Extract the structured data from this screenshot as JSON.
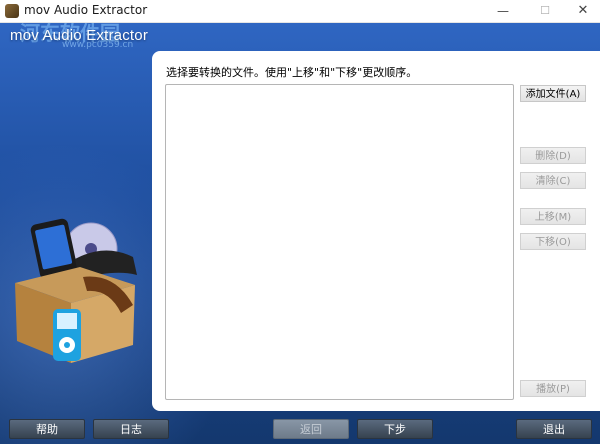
{
  "window": {
    "title": "mov Audio Extractor",
    "minimize": "—",
    "maximize": "☐",
    "close": "✕"
  },
  "brand": {
    "app_name": "mov Audio Extractor",
    "watermark": "河东软件园",
    "watermark_url": "www.pc0359.cn"
  },
  "panel": {
    "instruction": "选择要转换的文件。使用\"上移\"和\"下移\"更改顺序。"
  },
  "side_buttons": {
    "add": "添加文件(A)",
    "delete": "删除(D)",
    "clear": "清除(C)",
    "move_up": "上移(M)",
    "move_down": "下移(O)",
    "play": "播放(P)"
  },
  "bottom_buttons": {
    "help": "帮助",
    "log": "日志",
    "back": "返回",
    "next": "下步",
    "exit": "退出"
  },
  "colors": {
    "background_blue": "#1f4f9f",
    "panel": "#ffffff",
    "button_dark": "#36424f"
  }
}
